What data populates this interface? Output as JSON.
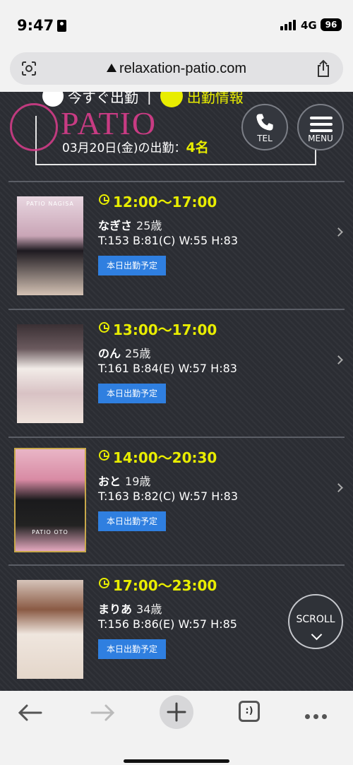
{
  "status": {
    "time": "9:47",
    "network": "4G",
    "battery": "96"
  },
  "browser": {
    "url": "relaxation-patio.com"
  },
  "header": {
    "top_strip_label": "今すぐ出勤",
    "top_strip_info": "出勤情報",
    "logo_text": "PATIO",
    "attendance_prefix": "03月20日(金)の出勤：",
    "attendance_count": "4名",
    "tel_label": "TEL",
    "menu_label": "MENU"
  },
  "schedule": [
    {
      "time": "12:00〜17:00",
      "name": "なぎさ",
      "age": "25歳",
      "stats": "T:153 B:81(C) W:55 H:83",
      "badge": "本日出勤予定",
      "photo_label": "PATIO  NAGISA"
    },
    {
      "time": "13:00〜17:00",
      "name": "のん",
      "age": "25歳",
      "stats": "T:161 B:84(E) W:57 H:83",
      "badge": "本日出勤予定",
      "photo_label": ""
    },
    {
      "time": "14:00〜20:30",
      "name": "おと",
      "age": "19歳",
      "stats": "T:163 B:82(C) W:57 H:83",
      "badge": "本日出勤予定",
      "photo_label": "PATIO OTO"
    },
    {
      "time": "17:00〜23:00",
      "name": "まりあ",
      "age": "34歳",
      "stats": "T:156 B:86(E) W:57 H:85",
      "badge": "本日出勤予定",
      "photo_label": ""
    }
  ],
  "scroll_label": "SCROLL",
  "toolbar": {
    "tabs_glyph": ":)"
  },
  "colors": {
    "accent_yellow": "#e8ed00",
    "badge_blue": "#2f7fe0",
    "logo_pink": "#d93d8c"
  }
}
